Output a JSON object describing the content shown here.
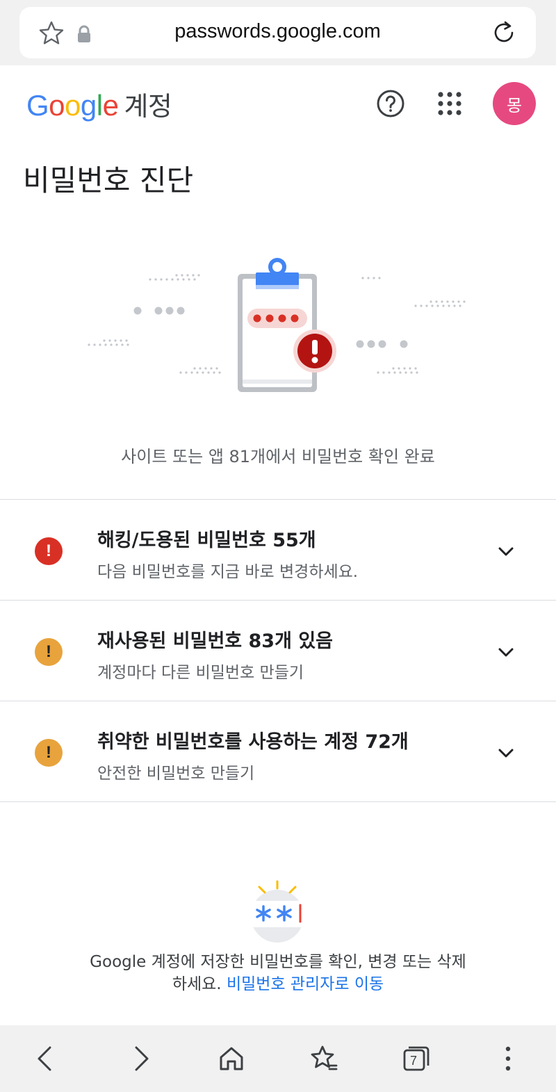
{
  "browser": {
    "url": "passwords.google.com",
    "tab_count": "7"
  },
  "header": {
    "logo_letters": [
      "G",
      "o",
      "o",
      "g",
      "l",
      "e"
    ],
    "product": "계정",
    "avatar_initial": "몽",
    "avatar_color": "#e64980"
  },
  "page": {
    "title": "비밀번호 진단",
    "summary": "사이트 또는 앱 81개에서 비밀번호 확인 완료"
  },
  "issues": [
    {
      "title": "해킹/도용된 비밀번호 55개",
      "subtitle": "다음 비밀번호를 지금 바로 변경하세요.",
      "severity": "critical",
      "color": "#d93025"
    },
    {
      "title": "재사용된 비밀번호 83개 있음",
      "subtitle": "계정마다 다른 비밀번호 만들기",
      "severity": "warning",
      "color": "#e8a33d"
    },
    {
      "title": "취약한 비밀번호를 사용하는 계정 72개",
      "subtitle": "안전한 비밀번호 만들기",
      "severity": "warning",
      "color": "#e8a33d"
    }
  ],
  "footer": {
    "text_line1": "Google 계정에 저장한 비밀번호를 확인, 변경 또는 삭제",
    "text_line2": "하세요.",
    "link": "비밀번호 관리자로 이동"
  },
  "icons": [
    "star-icon",
    "lock-icon",
    "reload-icon",
    "help-icon",
    "apps-icon",
    "alert-icon",
    "chevron-down-icon",
    "back-icon",
    "forward-icon",
    "home-icon",
    "bookmarks-icon",
    "tabs-icon",
    "more-icon"
  ]
}
